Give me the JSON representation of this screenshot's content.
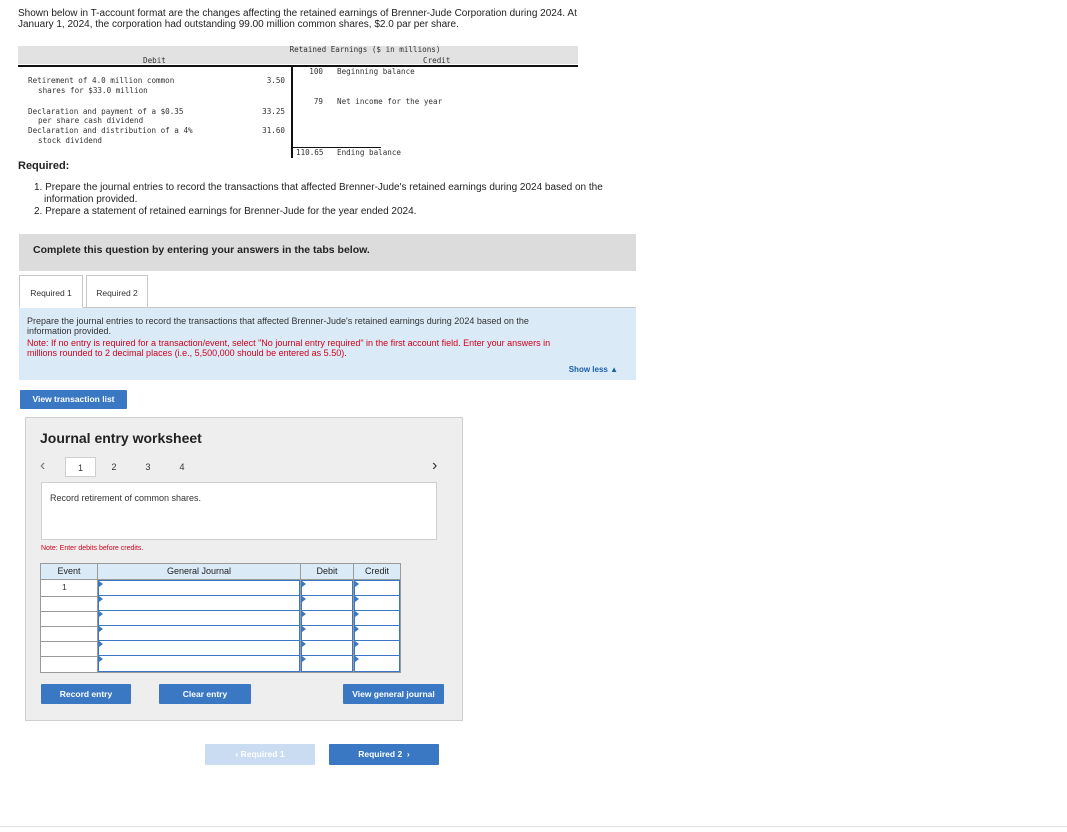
{
  "intro": {
    "line1": "Shown below in T-account format are the changes affecting the retained earnings of Brenner-Jude Corporation during 2024. At",
    "line2": "January 1, 2024, the corporation had outstanding 99.00 million common shares, $2.0 par per share."
  },
  "t_account": {
    "title": "Retained Earnings ($ in millions)",
    "debit_label": "Debit",
    "credit_label": "Credit",
    "debits": [
      {
        "text1": "Retirement of 4.0 million common",
        "text2": "shares for $33.0 million",
        "amount": "3.50"
      },
      {
        "text1": "Declaration and payment of a $0.35",
        "text2": "per share cash dividend",
        "amount": "33.25"
      },
      {
        "text1": "Declaration and distribution of a 4%",
        "text2": "stock dividend",
        "amount": "31.60"
      }
    ],
    "credits": [
      {
        "amount": "100",
        "text": "Beginning balance"
      },
      {
        "amount": "79",
        "text": "Net income for the year"
      }
    ],
    "ending": {
      "amount": "110.65",
      "text": "Ending balance"
    }
  },
  "required": {
    "heading": "Required:",
    "item1a": "1. Prepare the journal entries to record the transactions that affected Brenner-Jude's retained earnings during 2024 based on the",
    "item1b": "information provided.",
    "item2": "2. Prepare a statement of retained earnings for Brenner-Jude for the year ended 2024."
  },
  "complete_bar": "Complete this question by entering your answers in the tabs below.",
  "tabs": [
    "Required 1",
    "Required 2"
  ],
  "instructions": {
    "p1a": "Prepare the journal entries to record the transactions that affected Brenner-Jude's retained earnings during 2024 based on the",
    "p1b": "information provided.",
    "p2a": "Note: If no entry is required for a transaction/event, select \"No journal entry required\" in the first account field. Enter your answers in",
    "p2b": "millions rounded to 2 decimal places (i.e., 5,500,000 should be entered as 5.50).",
    "show_less": "Show less"
  },
  "buttons": {
    "view_transaction_list": "View transaction list",
    "record_entry": "Record entry",
    "clear_entry": "Clear entry",
    "view_general_journal": "View general journal",
    "prev_tab": "Required 1",
    "next_tab": "Required 2"
  },
  "worksheet": {
    "title": "Journal entry worksheet",
    "pages": [
      "1",
      "2",
      "3",
      "4"
    ],
    "description": "Record retirement of common shares.",
    "note": "Note: Enter debits before credits.",
    "columns": {
      "event": "Event",
      "journal": "General Journal",
      "debit": "Debit",
      "credit": "Credit"
    },
    "first_event": "1"
  },
  "colors": {
    "accent": "#3a78c4",
    "note_red": "#d0021b",
    "instr_bg": "#dbeaf7"
  }
}
